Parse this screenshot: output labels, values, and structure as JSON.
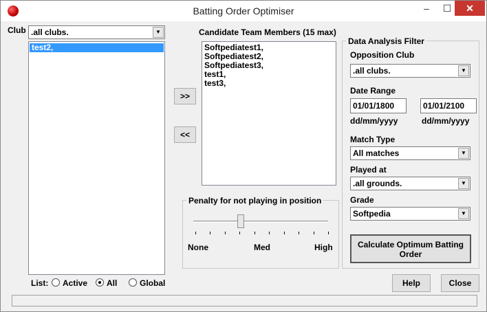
{
  "window": {
    "title": "Batting Order Optimiser",
    "controls": {
      "minimize": "–",
      "maximize": "☐",
      "close": "✕"
    }
  },
  "club": {
    "label": "Club",
    "selected": ".all clubs.",
    "list_items": [
      "test2,"
    ],
    "list_filter": {
      "label": "List:",
      "options": [
        "Active",
        "All",
        "Global"
      ],
      "selected": "All"
    }
  },
  "transfer": {
    "add_label": ">>",
    "remove_label": "<<"
  },
  "candidates": {
    "title": "Candidate Team Members (15 max)",
    "items": [
      "Softpediatest1,",
      "Softpediatest2,",
      "Softpediatest3,",
      "test1,",
      "test3,"
    ]
  },
  "penalty": {
    "title": "Penalty for not playing in position",
    "labels": {
      "none": "None",
      "med": "Med",
      "high": "High"
    },
    "level_fraction": 0.35
  },
  "filter": {
    "title": "Data Analysis Filter",
    "opposition_club": {
      "label": "Opposition Club",
      "value": ".all clubs."
    },
    "date_range": {
      "label": "Date Range",
      "from": "01/01/1800",
      "to": "01/01/2100",
      "format_hint": "dd/mm/yyyy"
    },
    "match_type": {
      "label": "Match Type",
      "value": "All matches"
    },
    "played_at": {
      "label": "Played at",
      "value": ".all grounds."
    },
    "grade": {
      "label": "Grade",
      "value": "Softpedia"
    },
    "calculate_label": "Calculate Optimum Batting Order"
  },
  "footer": {
    "help_label": "Help",
    "close_label": "Close"
  },
  "icons": {
    "app": "cricket-ball-icon",
    "dropdown": "chevron-down-icon"
  }
}
